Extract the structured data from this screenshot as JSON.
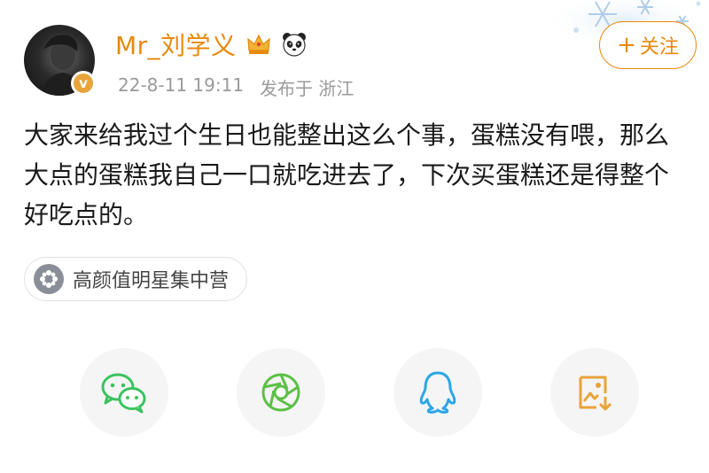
{
  "user": {
    "name": "Mr_刘学义",
    "verified_mark": "v",
    "badges": [
      "crown-icon",
      "panda-icon"
    ]
  },
  "post": {
    "time": "22-8-11 19:11",
    "location": "发布于 浙江",
    "text": "大家来给我过个生日也能整出这么个事，蛋糕没有喂，那么大点的蛋糕我自己一口就吃进去了，下次买蛋糕还是得整个好吃点的。"
  },
  "follow": {
    "plus": "+",
    "label": "关注"
  },
  "topic": {
    "label": "高颜值明星集中营",
    "icon": "flower-icon"
  },
  "share": {
    "icons": [
      "wechat-icon",
      "moments-icon",
      "qq-icon",
      "save-image-icon"
    ]
  },
  "colors": {
    "accent": "#e8890c",
    "meta": "#9a9a9a",
    "wechat": "#3cc25f",
    "qq": "#2aa6e8",
    "save": "#e8a33a"
  }
}
